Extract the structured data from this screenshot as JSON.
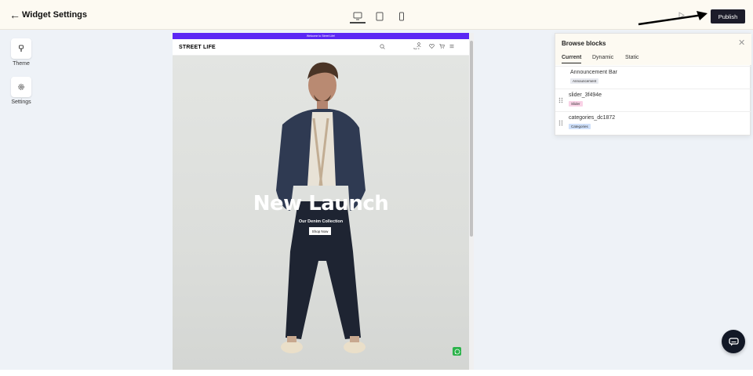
{
  "header": {
    "back_icon": "arrow-left-icon",
    "title": "Widget Settings",
    "devices": [
      "desktop-icon",
      "tablet-icon",
      "mobile-icon"
    ],
    "preview_icon": "play-icon",
    "publish_label": "Publish"
  },
  "sidebar": {
    "items": [
      {
        "label": "Theme",
        "icon": "paint-brush-icon"
      },
      {
        "label": "Settings",
        "icon": "gear-icon"
      }
    ]
  },
  "preview": {
    "announcement_text": "Welcome to Street Life!",
    "store_logo": "STREET LIFE",
    "sign_in_label": "Sign In",
    "hero_title": "New Launch",
    "hero_subtitle": "Our Denim Collection",
    "shop_button_label": "Shop Now",
    "colors": {
      "announcement_bg": "#5b26f4",
      "whatsapp": "#2bb34a"
    }
  },
  "blocks_panel": {
    "title": "Browse blocks",
    "tabs": [
      {
        "label": "Current",
        "active": true
      },
      {
        "label": "Dynamic",
        "active": false
      },
      {
        "label": "Static",
        "active": false
      }
    ],
    "blocks": [
      {
        "name": "Announcement Bar",
        "badge": "Announcement",
        "badge_color": "#e8eaf0",
        "draggable": false
      },
      {
        "name": "slider_3f494e",
        "badge": "Slider",
        "badge_color": "#f9d2e6",
        "draggable": true
      },
      {
        "name": "categories_dc1872",
        "badge": "Categories",
        "badge_color": "#cfe0fa",
        "draggable": true
      }
    ]
  },
  "accent_colors": {
    "publish_bg": "#1c1c2a",
    "topbar_bg": "#fdfaf2",
    "canvas_bg": "#eef2f7"
  }
}
